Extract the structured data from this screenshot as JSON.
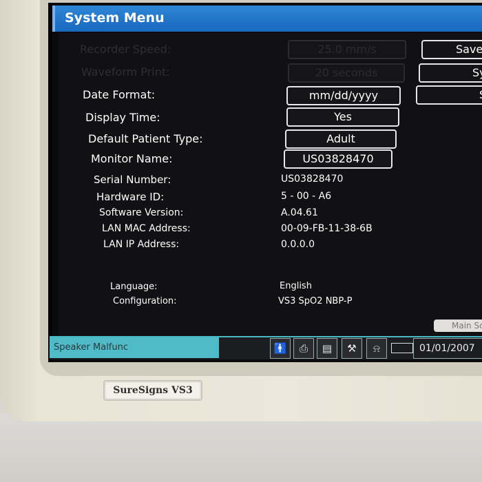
{
  "window": {
    "title": "System Menu"
  },
  "settings": [
    {
      "label": "Recorder Speed:",
      "value": "25.0 mm/s",
      "enabled": false
    },
    {
      "label": "Waveform Print:",
      "value": "20 seconds",
      "enabled": false
    },
    {
      "label": "Date Format:",
      "value": "mm/dd/yyyy",
      "enabled": true
    },
    {
      "label": "Display Time:",
      "value": "Yes",
      "enabled": true
    },
    {
      "label": "Default Patient Type:",
      "value": "Adult",
      "enabled": true
    },
    {
      "label": "Monitor Name:",
      "value": "US03828470",
      "enabled": true
    }
  ],
  "info": [
    {
      "label": "Serial Number:",
      "value": "US03828470"
    },
    {
      "label": "Hardware ID:",
      "value": "5 - 00 - A6"
    },
    {
      "label": "Software Version:",
      "value": "A.04.61"
    },
    {
      "label": "LAN MAC Address:",
      "value": "00-09-FB-11-38-6B"
    },
    {
      "label": "LAN IP Address:",
      "value": "0.0.0.0"
    },
    {
      "label": "Language:",
      "value": "English"
    },
    {
      "label": "Configuration:",
      "value": "VS3 SpO2 NBP-P"
    }
  ],
  "side_buttons": {
    "save": "Save",
    "system": "Sys",
    "third": "S"
  },
  "main_screen_tab": "Main Sc",
  "status_bar": {
    "alarm": "Speaker Malfunc",
    "icons": [
      "person-icon",
      "printer-icon",
      "display-icon",
      "wrench-icon",
      "bell-icon",
      "battery-icon"
    ],
    "date": "01/01/2007",
    "alarm_color": "#4fbac8"
  },
  "device": {
    "brand": "SureSigns VS3"
  }
}
